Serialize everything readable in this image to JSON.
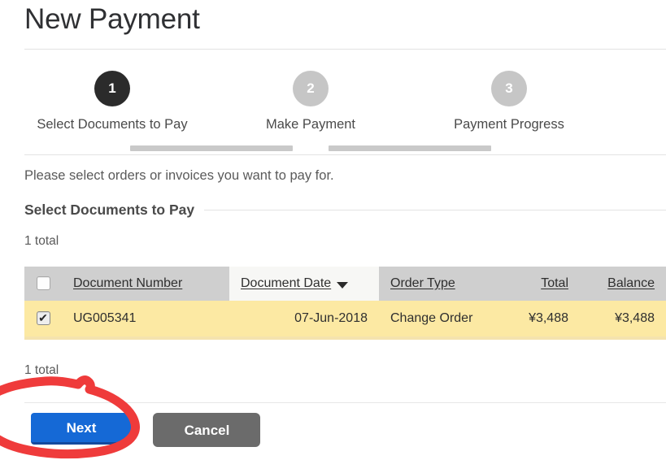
{
  "page": {
    "title": "New Payment",
    "intro": "Please select orders or invoices you want to pay for."
  },
  "stepper": {
    "steps": [
      {
        "number": "1",
        "label": "Select Documents to Pay",
        "state": "active"
      },
      {
        "number": "2",
        "label": "Make Payment",
        "state": "inactive"
      },
      {
        "number": "3",
        "label": "Payment Progress",
        "state": "inactive"
      }
    ]
  },
  "section": {
    "heading": "Select Documents to Pay",
    "total_top": "1 total",
    "total_bottom": "1 total"
  },
  "table": {
    "select_all_icon": "checkbox-unchecked-icon",
    "columns": [
      {
        "label": "Document Number",
        "align": "left",
        "sorted": false
      },
      {
        "label": "Document Date",
        "align": "left",
        "sorted": true,
        "sort_icon": "chevron-down-icon"
      },
      {
        "label": "Order Type",
        "align": "left",
        "sorted": false
      },
      {
        "label": "Total",
        "align": "right",
        "sorted": false
      },
      {
        "label": "Balance",
        "align": "right",
        "sorted": false
      }
    ],
    "rows": [
      {
        "selected": true,
        "select_icon": "checkbox-checked-icon",
        "document_number": "UG005341",
        "document_date": "07-Jun-2018",
        "order_type": "Change Order",
        "total": "¥3,488",
        "balance": "¥3,488"
      }
    ]
  },
  "footer": {
    "next_label": "Next",
    "cancel_label": "Cancel"
  },
  "annotation": {
    "shape": "hand-drawn-ellipse",
    "target": "next-button",
    "color": "#ef3b3b"
  },
  "colors": {
    "primary_button": "#1569d6",
    "secondary_button": "#6b6b6b",
    "row_highlight": "#fce9a3",
    "table_header": "#cfcfcf",
    "step_active": "#2b2b2b",
    "step_inactive": "#c6c6c6",
    "annotation_red": "#ef3b3b"
  }
}
